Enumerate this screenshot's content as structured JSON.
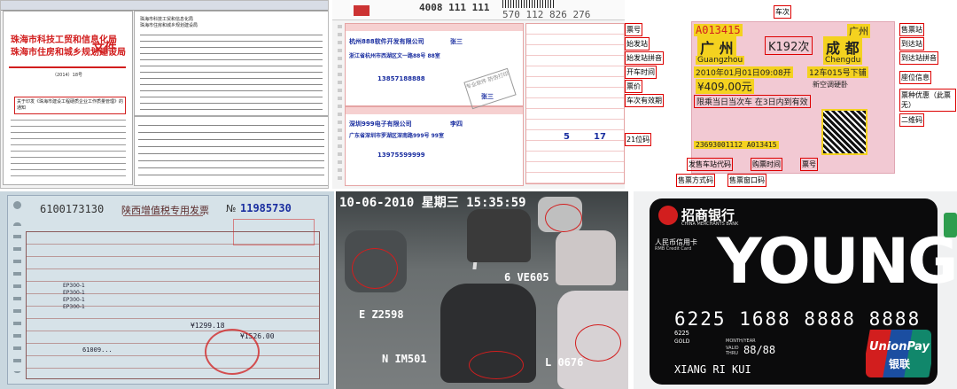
{
  "doc_panel": {
    "header_lines": [
      "珠海市科技工贸和信息化局",
      "珠海市住房和城乡规划建设局"
    ],
    "heading": "珠海市科技工贸和信息化局",
    "heading2": "珠海市住房和城乡规划建设局",
    "wen": "文件",
    "doc_number": "（2014）18号",
    "subject": "关于印发《珠海市建设工程硬质企业工作质量管理》的通知"
  },
  "waybill_panel": {
    "hotline": "4008 111 111",
    "tracking": "570 112 826 276",
    "sender_company": "杭州888软件开发有限公司",
    "sender_name": "张三",
    "sender_address": "浙江省杭州市西湖区文一路88号 88室",
    "sender_phone": "13857188888",
    "receiver_company": "深圳999电子有限公司",
    "receiver_name": "李四",
    "receiver_address": "广东省深圳市罗湖区深南路999号 99室",
    "receiver_phone": "13975599999",
    "stamp": "专业软件 防伪打印",
    "name_tag": "张三",
    "nums": [
      "5",
      "17"
    ]
  },
  "train_panel": {
    "ticket_no": "A013415",
    "from_station": "广 州",
    "to_station": "成 都",
    "from_pinyin": "Guangzhou",
    "to_pinyin": "Chengdu",
    "train_no": "K192次",
    "departure": "2010年01月01日09:08开",
    "price": "¥409.00元",
    "seat": "12车015号下铺",
    "seat_class": "新空调硬卧",
    "validity": "限乘当日当次车 在3日内到有效",
    "sold_at": "广州",
    "code": "23693001112 A013415",
    "callouts": [
      "车次",
      "票号",
      "始发站",
      "始发站拼音",
      "开车时间",
      "票价",
      "车次有效期",
      "售票站",
      "到达站",
      "到达站拼音",
      "座位信息",
      "票种优惠（此票无）",
      "二维码",
      "21位码",
      "发售车站代码",
      "售票方式码",
      "售票窗口码",
      "购票时间",
      "票号"
    ]
  },
  "invoice_panel": {
    "number_left": "6100173130",
    "title": "陕西增值税专用发票",
    "number_right": "11985730",
    "no_label": "№",
    "total": "¥1526.00",
    "amount": "¥1299.18",
    "tax_rows": [
      "EP300-1",
      "EP300-1",
      "EP300-1",
      "EP300-1"
    ],
    "seller_code": "61009..."
  },
  "traffic_panel": {
    "timestamp": "10-06-2010 星期三 15:35:59",
    "plates": [
      "6 VE605",
      "E Z2598",
      "N IM501",
      "L 0676"
    ]
  },
  "card_panel": {
    "bank_name": "招商银行",
    "bank_en": "CHINA MERCHANTS BANK",
    "card_type": "人民币信用卡",
    "card_type_en": "RMB Credit Card",
    "brand": "YOUNG",
    "card_number": "6225 1688 8888 8888",
    "small_number": "6225",
    "gold": "GOLD",
    "valid_label": "VALID THRU",
    "expiry": "88/88",
    "month_year": "MONTH/YEAR",
    "holder": "XIANG RI KUI",
    "unionpay": "UnionPay",
    "unionpay_cn": "银联"
  }
}
